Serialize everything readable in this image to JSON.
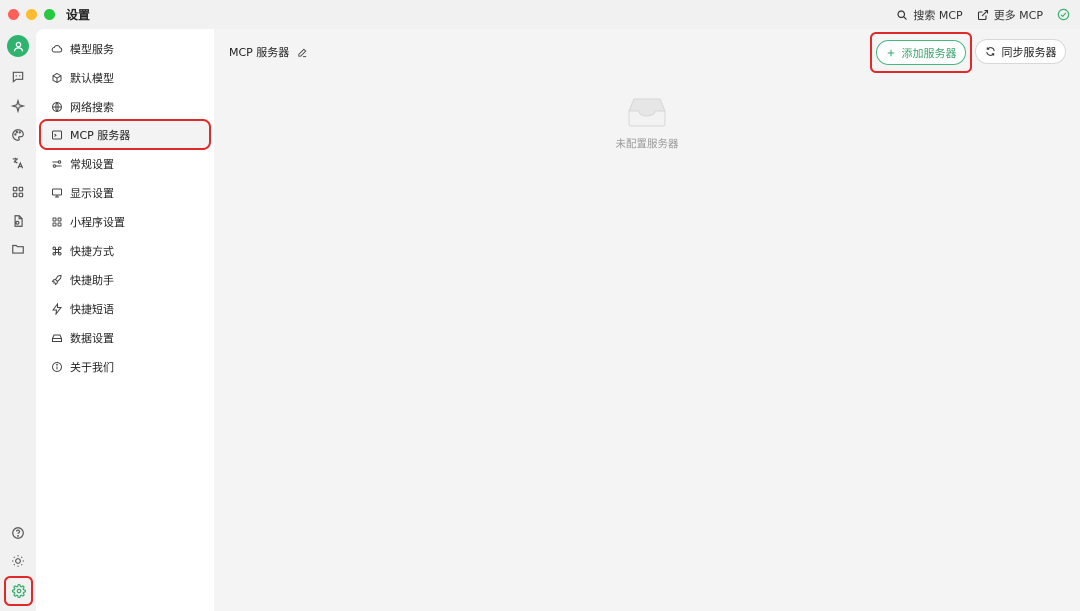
{
  "window": {
    "title": "设置"
  },
  "title_actions": [
    {
      "icon": "search-icon",
      "label": "搜索 MCP"
    },
    {
      "icon": "external-link-icon",
      "label": "更多 MCP"
    }
  ],
  "status": {
    "icon": "check-circle-icon",
    "color": "#3bb56d"
  },
  "rail": {
    "avatar_color": "#2fb46f",
    "icons": [
      "chat-icon",
      "sparkle-icon",
      "palette-icon",
      "translate-icon",
      "grid-apps-icon",
      "document-icon",
      "folder-icon"
    ],
    "bottom_icons": [
      "help-icon",
      "sun-icon",
      "settings-icon"
    ]
  },
  "nav": {
    "items": [
      {
        "icon": "cloud-icon",
        "label": "模型服务"
      },
      {
        "icon": "cube-icon",
        "label": "默认模型"
      },
      {
        "icon": "globe-icon",
        "label": "网络搜索"
      },
      {
        "icon": "terminal-icon",
        "label": "MCP 服务器",
        "active": true
      },
      {
        "icon": "sliders-icon",
        "label": "常规设置"
      },
      {
        "icon": "monitor-icon",
        "label": "显示设置"
      },
      {
        "icon": "grid-icon",
        "label": "小程序设置"
      },
      {
        "icon": "command-icon",
        "label": "快捷方式"
      },
      {
        "icon": "rocket-icon",
        "label": "快捷助手"
      },
      {
        "icon": "zap-icon",
        "label": "快捷短语"
      },
      {
        "icon": "hard-drive-icon",
        "label": "数据设置"
      },
      {
        "icon": "info-icon",
        "label": "关于我们"
      }
    ]
  },
  "main": {
    "title": "MCP 服务器",
    "add_button": "添加服务器",
    "sync_button": "同步服务器",
    "empty_text": "未配置服务器"
  },
  "colors": {
    "accent": "#3aa36f",
    "highlight_outline": "#e02a2a"
  }
}
